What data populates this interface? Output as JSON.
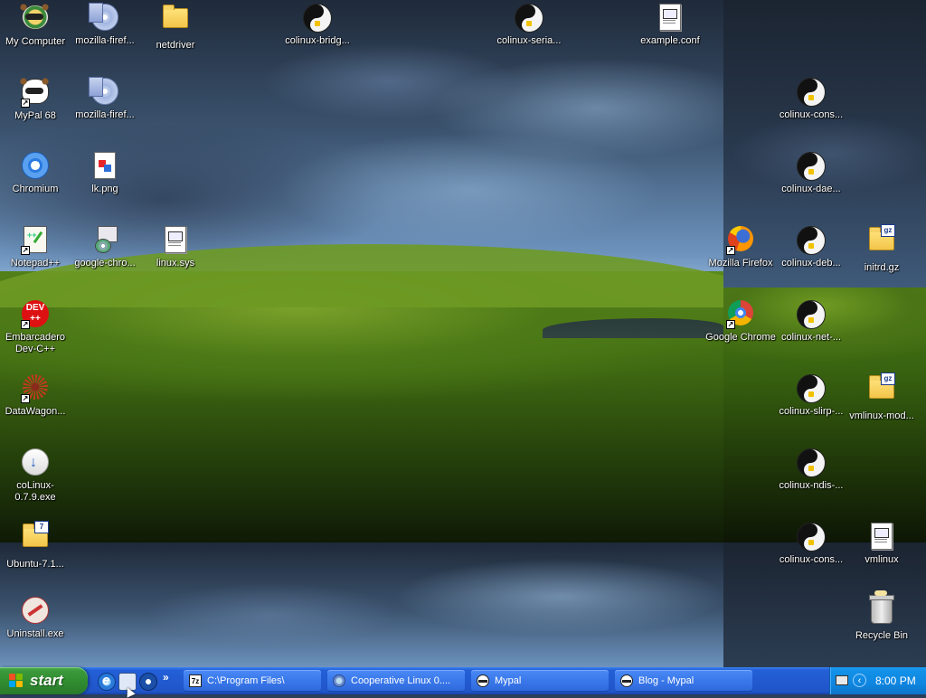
{
  "desktop": {
    "icons": [
      {
        "id": "my-computer",
        "label": "My Computer"
      },
      {
        "id": "mozilla-firefox-1",
        "label": "mozilla-firef..."
      },
      {
        "id": "netdriver",
        "label": "netdriver"
      },
      {
        "id": "colinux-bridge",
        "label": "colinux-bridg..."
      },
      {
        "id": "colinux-serial",
        "label": "colinux-seria..."
      },
      {
        "id": "example-conf",
        "label": "example.conf"
      },
      {
        "id": "mypal-68",
        "label": "MyPal 68"
      },
      {
        "id": "mozilla-firefox-2",
        "label": "mozilla-firef..."
      },
      {
        "id": "colinux-console-1",
        "label": "colinux-cons..."
      },
      {
        "id": "chromium",
        "label": "Chromium"
      },
      {
        "id": "lk-png",
        "label": "lk.png"
      },
      {
        "id": "colinux-daemon",
        "label": "colinux-dae..."
      },
      {
        "id": "notepad-plus-plus",
        "label": "Notepad++"
      },
      {
        "id": "google-chrome-installer",
        "label": "google-chro..."
      },
      {
        "id": "linux-sys",
        "label": "linux.sys"
      },
      {
        "id": "mozilla-firefox-shortcut",
        "label": "Mozilla Firefox"
      },
      {
        "id": "colinux-debug",
        "label": "colinux-deb..."
      },
      {
        "id": "initrd-gz",
        "label": "initrd.gz"
      },
      {
        "id": "embarcadero-dev-cpp",
        "label": "Embarcadero Dev-C++"
      },
      {
        "id": "google-chrome-shortcut",
        "label": "Google Chrome"
      },
      {
        "id": "colinux-net",
        "label": "colinux-net-..."
      },
      {
        "id": "datawagon",
        "label": "DataWagon..."
      },
      {
        "id": "colinux-slirp",
        "label": "colinux-slirp-..."
      },
      {
        "id": "vmlinux-modules",
        "label": "vmlinux-mod..."
      },
      {
        "id": "colinux-installer",
        "label": "coLinux-0.7.9.exe"
      },
      {
        "id": "colinux-ndis",
        "label": "colinux-ndis-..."
      },
      {
        "id": "ubuntu-7z",
        "label": "Ubuntu-7.1..."
      },
      {
        "id": "colinux-console-2",
        "label": "colinux-cons..."
      },
      {
        "id": "vmlinux",
        "label": "vmlinux"
      },
      {
        "id": "uninstall-exe",
        "label": "Uninstall.exe"
      },
      {
        "id": "recycle-bin",
        "label": "Recycle Bin"
      }
    ]
  },
  "icon_art": {
    "dev_cpp": "DEV ++",
    "archive_7z": "7",
    "archive_gz": "gz",
    "shortcut_arrow": "↗"
  },
  "taskbar": {
    "start_label": "start",
    "quicklaunch_more": "»",
    "tasks": [
      {
        "label": "C:\\Program Files\\",
        "icon": "7z-icon",
        "icon_text": "7z"
      },
      {
        "label": "Cooperative Linux 0....",
        "icon": "globe-icon"
      },
      {
        "label": "Mypal",
        "icon": "raccoon-icon"
      },
      {
        "label": "Blog - Mypal",
        "icon": "raccoon-icon"
      }
    ],
    "tray": {
      "expand_glyph": "‹",
      "clock": "8:00 PM"
    }
  },
  "colors": {
    "taskbar_blue": "#225ad0",
    "start_green": "#3a983a",
    "tray_blue": "#0f86e0"
  }
}
